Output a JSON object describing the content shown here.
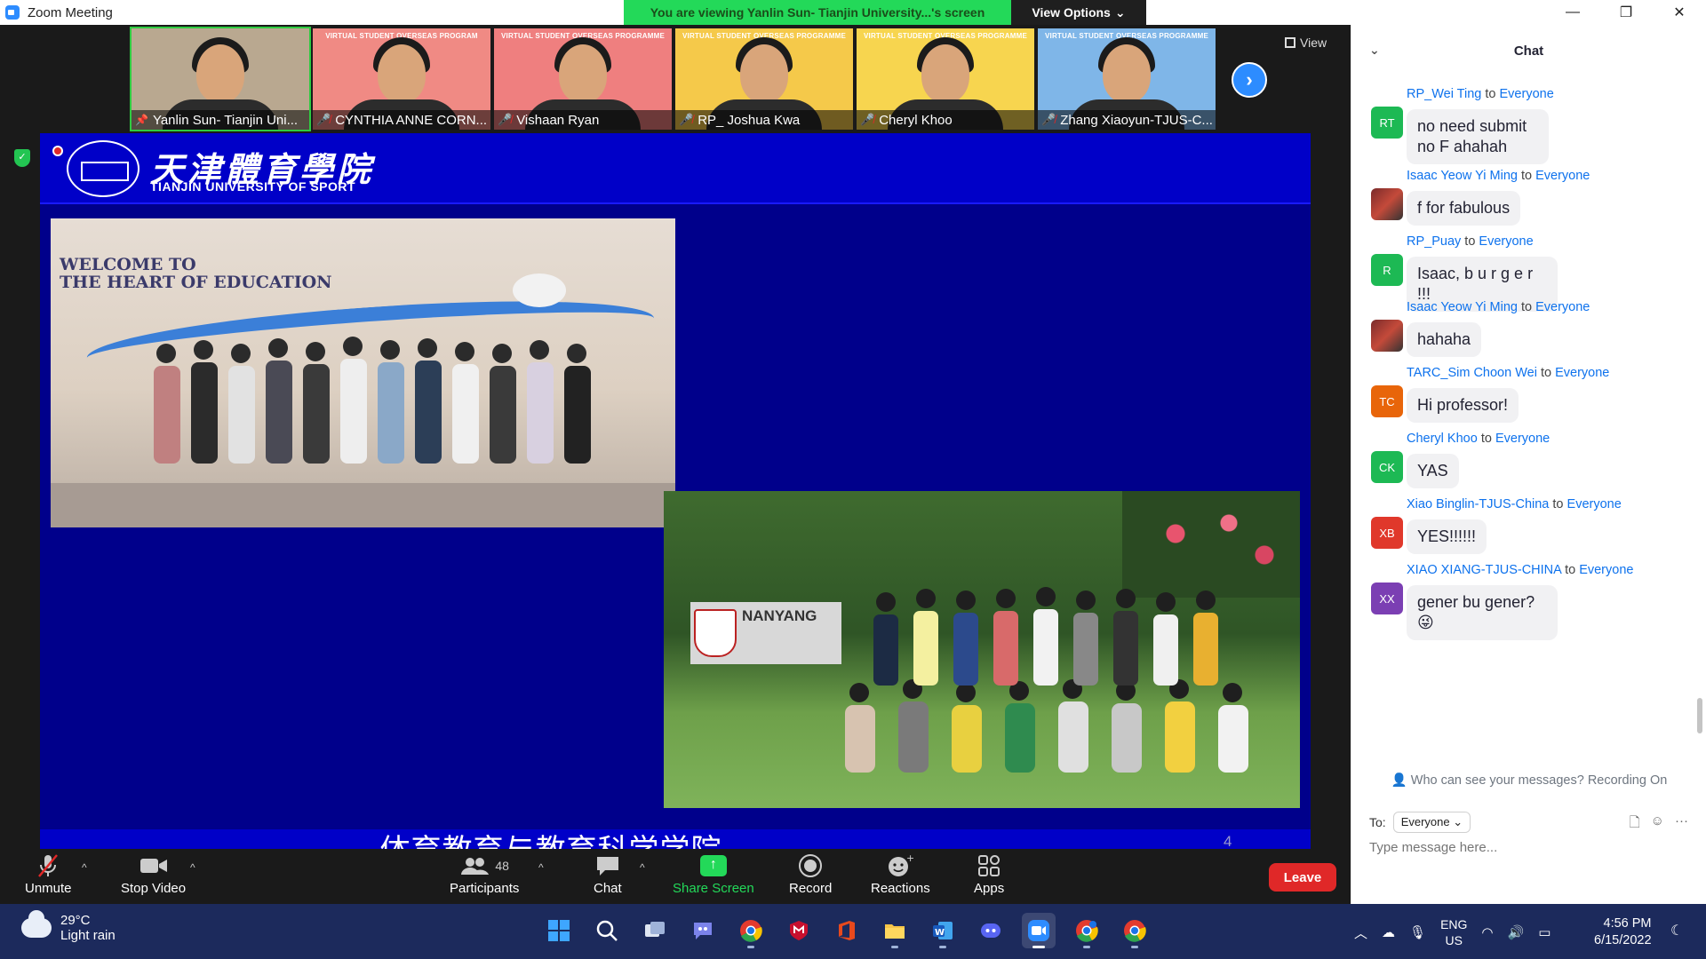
{
  "window": {
    "title": "Zoom Meeting"
  },
  "share_banner": {
    "text": "You are viewing Yanlin Sun- Tianjin University...'s screen",
    "view_options_label": "View Options"
  },
  "view_button_label": "View",
  "participants_strip": [
    {
      "name": "Yanlin Sun- Tianjin Uni...",
      "pinned": true,
      "muted": false,
      "bg": "#b9a890",
      "program": ""
    },
    {
      "name": "CYNTHIA ANNE CORN...",
      "pinned": false,
      "muted": true,
      "bg": "#f08a84",
      "program": "VIRTUAL STUDENT OVERSEAS PROGRAM"
    },
    {
      "name": "Vishaan Ryan",
      "pinned": false,
      "muted": true,
      "bg": "#ef7f7f",
      "program": "VIRTUAL STUDENT OVERSEAS PROGRAMME"
    },
    {
      "name": "RP_ Joshua Kwa",
      "pinned": false,
      "muted": true,
      "bg": "#f5c94a",
      "program": "VIRTUAL STUDENT OVERSEAS PROGRAMME"
    },
    {
      "name": "Cheryl Khoo",
      "pinned": false,
      "muted": true,
      "bg": "#f7d54f",
      "program": "VIRTUAL STUDENT OVERSEAS PROGRAMME"
    },
    {
      "name": "Zhang Xiaoyun-TJUS-C...",
      "pinned": false,
      "muted": true,
      "bg": "#7fb6e8",
      "program": "VIRTUAL STUDENT OVERSEAS PROGRAMME"
    }
  ],
  "slide": {
    "university_cn": "天津體育學院",
    "university_en": "TIANJIN UNIVERSITY OF SPORT",
    "photo1_wall_text": [
      "WELCOME TO",
      "THE HEART OF EDUCATION"
    ],
    "photo2_sign_text": "NANYANG",
    "caption": "体育教育与教育科学学院",
    "page_number": "4"
  },
  "toolbar": {
    "unmute": "Unmute",
    "stop_video": "Stop Video",
    "participants": "Participants",
    "participants_count": "48",
    "chat": "Chat",
    "share_screen": "Share Screen",
    "record": "Record",
    "reactions": "Reactions",
    "apps": "Apps",
    "leave": "Leave"
  },
  "chat": {
    "title": "Chat",
    "to_word": "to",
    "messages": [
      {
        "sender": "RP_Wei Ting",
        "recipient": "Everyone",
        "initials": "RT",
        "avatar_color": "#1db954",
        "text": "no need submit no F ahahah",
        "photo": false
      },
      {
        "sender": "Isaac Yeow Yi Ming",
        "recipient": "Everyone",
        "initials": "",
        "avatar_color": "#8b2e2e",
        "text": "f for fabulous",
        "photo": true
      },
      {
        "sender": "RP_Puay",
        "recipient": "Everyone",
        "initials": "R",
        "avatar_color": "#1db954",
        "text": "Isaac, b u r g e r !!!",
        "photo": false
      },
      {
        "sender": "Isaac Yeow Yi Ming",
        "recipient": "Everyone",
        "initials": "",
        "avatar_color": "#8b2e2e",
        "text": "hahaha",
        "photo": true
      },
      {
        "sender": "TARC_Sim Choon Wei",
        "recipient": "Everyone",
        "initials": "TC",
        "avatar_color": "#e8650a",
        "text": "Hi professor!",
        "photo": false
      },
      {
        "sender": "Cheryl Khoo",
        "recipient": "Everyone",
        "initials": "CK",
        "avatar_color": "#1db954",
        "text": "YAS",
        "photo": false
      },
      {
        "sender": "Xiao Binglin-TJUS-China",
        "recipient": "Everyone",
        "initials": "XB",
        "avatar_color": "#e0382b",
        "text": "YES!!!!!!",
        "photo": false
      },
      {
        "sender": "XIAO XIANG-TJUS-CHINA",
        "recipient": "Everyone",
        "initials": "XX",
        "avatar_color": "#7b3fb3",
        "text": "gener bu gener?😜",
        "photo": false
      }
    ],
    "recording_note": "Who can see your messages? Recording On",
    "to_label": "To:",
    "to_value": "Everyone",
    "input_placeholder": "Type message here..."
  },
  "taskbar": {
    "temperature": "29°C",
    "weather": "Light rain",
    "lang_top": "ENG",
    "lang_bottom": "US",
    "time": "4:56 PM",
    "date": "6/15/2022"
  }
}
